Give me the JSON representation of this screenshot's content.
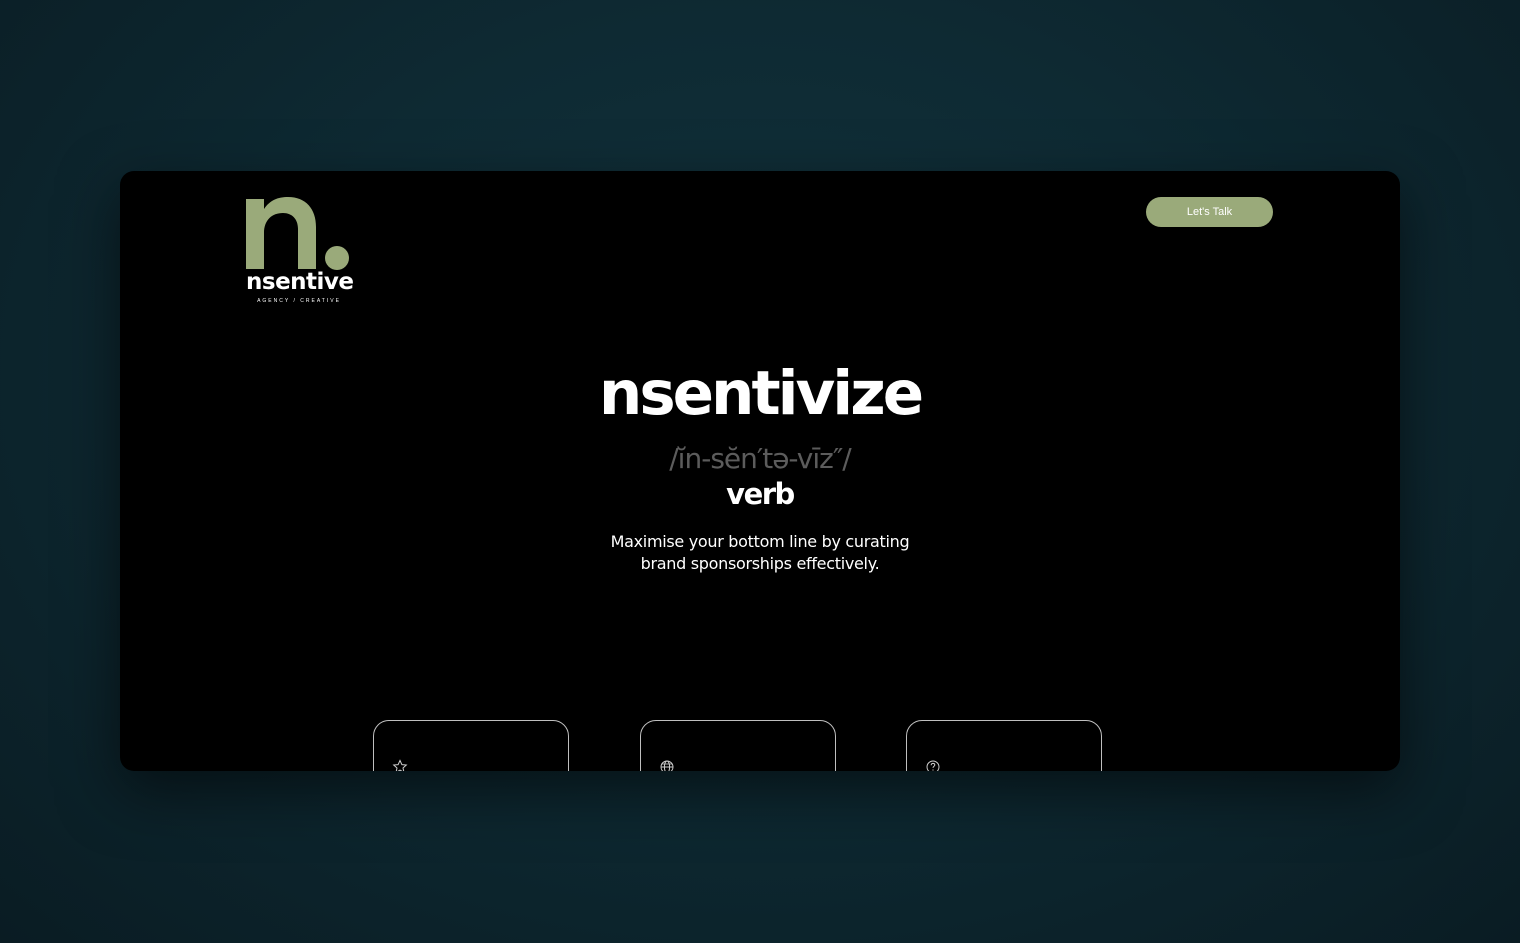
{
  "logo": {
    "brand": "nsentive",
    "tagline": "AGENCY / CREATIVE",
    "accent_color": "#9aaa7a"
  },
  "nav": {
    "cta_label": "Let's Talk"
  },
  "hero": {
    "word": "nsentivize",
    "pronunciation": "/ĭn-sĕn′tə-vīz″/",
    "part_of_speech": "verb",
    "tagline_line1": "Maximise your bottom line by curating",
    "tagline_line2": "brand sponsorships effectively."
  },
  "cards": [
    {
      "icon": "star-icon"
    },
    {
      "icon": "globe-icon"
    },
    {
      "icon": "question-icon"
    }
  ]
}
